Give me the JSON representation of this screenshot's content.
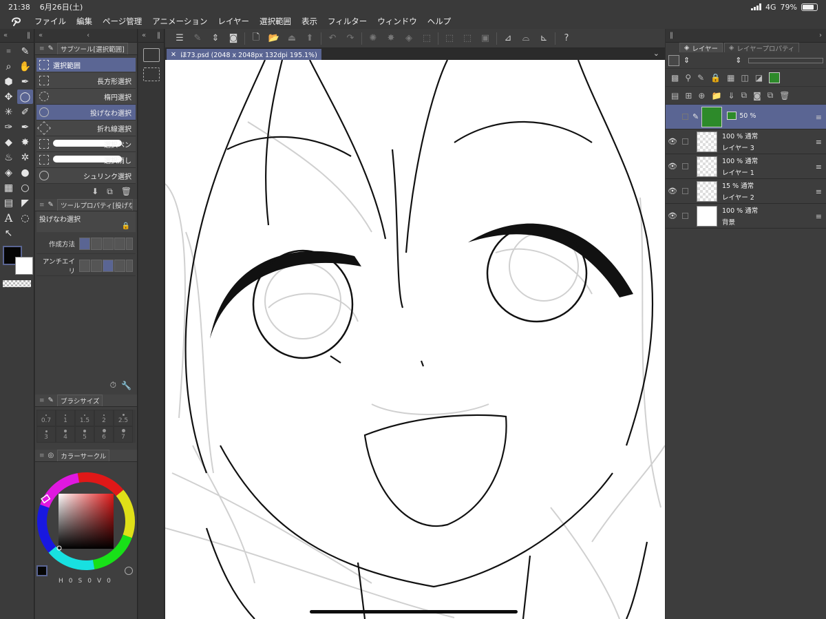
{
  "status": {
    "time": "21:38",
    "date": "6月26日(土)",
    "network": "4G",
    "battery": "79%",
    "battery_level": 0.79
  },
  "menu": [
    "ファイル",
    "編集",
    "ページ管理",
    "アニメーション",
    "レイヤー",
    "選択範囲",
    "表示",
    "フィルター",
    "ウィンドウ",
    "ヘルプ"
  ],
  "tools": {
    "items": [
      "brush-pen-icon",
      "zoom-icon",
      "hand-icon",
      "operation-icon",
      "pen-icon",
      "move-icon",
      "lasso-selection-icon",
      "magic-wand-icon",
      "eyedropper-icon",
      "pen-nib-icon",
      "fountain-pen-icon",
      "eraser-icon",
      "star-burst-icon",
      "airbrush-icon",
      "sparkle-icon",
      "fill-icon",
      "water-drop-icon",
      "gradient-icon",
      "circle-icon",
      "frame-icon",
      "ruler-icon",
      "text-icon",
      "balloon-icon",
      "correction-icon"
    ],
    "main_color": "#050505",
    "sub_color": "#ffffff"
  },
  "subtool": {
    "panel_title": "サブツール[選択範囲]",
    "group": "選択範囲",
    "items": [
      {
        "label": "長方形選択"
      },
      {
        "label": "楕円選択"
      },
      {
        "label": "投げなわ選択"
      },
      {
        "label": "折れ線選択"
      },
      {
        "label": "選択ペン"
      },
      {
        "label": "選択消し"
      },
      {
        "label": "シュリンク選択"
      }
    ]
  },
  "toolprop": {
    "panel_title": "ツールプロパティ[投げなわ",
    "tool_name": "投げなわ選択",
    "rows": [
      {
        "label": "作成方法"
      },
      {
        "label": "アンチエイリ"
      }
    ]
  },
  "brushsize": {
    "panel_title": "ブラシサイズ",
    "sizes": [
      "0.7",
      "1",
      "1.5",
      "2",
      "2.5",
      "3",
      "4",
      "5",
      "6",
      "7"
    ]
  },
  "colorcircle": {
    "panel_title": "カラーサークル",
    "hsv": [
      "H",
      "0",
      "S",
      "0",
      "V",
      "0"
    ]
  },
  "document": {
    "tab_label": "ほ73.psd (2048 x 2048px 132dpi 195.1%)"
  },
  "layers": {
    "tab_layer": "レイヤー",
    "tab_property": "レイヤープロパティ",
    "list": [
      {
        "opacity_blend": "50 %",
        "name": "",
        "thumb": "green",
        "active": true
      },
      {
        "opacity_blend": "100 % 通常",
        "name": "レイヤー 3",
        "thumb": "checker",
        "active": false
      },
      {
        "opacity_blend": "100 % 通常",
        "name": "レイヤー 1",
        "thumb": "checker",
        "active": false
      },
      {
        "opacity_blend": "15 % 通常",
        "name": "レイヤー 2",
        "thumb": "checker",
        "active": false
      },
      {
        "opacity_blend": "100 % 通常",
        "name": "背景",
        "thumb": "white",
        "active": false
      }
    ]
  },
  "accent_color": "#5a6593"
}
